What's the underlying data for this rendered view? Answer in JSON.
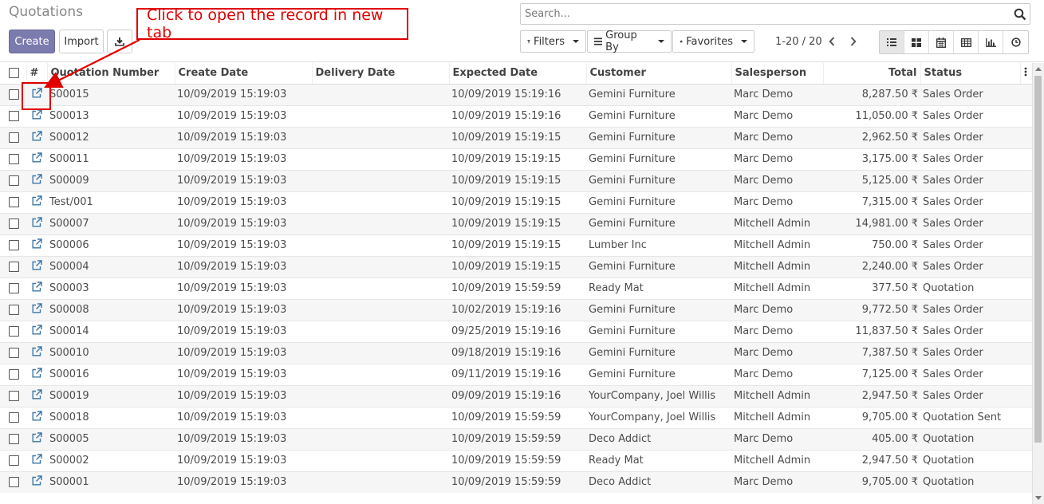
{
  "header": {
    "title": "Quotations",
    "create_label": "Create",
    "import_label": "Import",
    "search_placeholder": "Search...",
    "filters_label": "Filters",
    "groupby_label": "Group By",
    "favorites_label": "Favorites",
    "pager": "1-20 / 20"
  },
  "annotation": {
    "text": "Click to open the record in new tab",
    "color": "#e00000"
  },
  "colors": {
    "primary": "#7c7bad",
    "annotation": "#e00000"
  },
  "table": {
    "columns": [
      "#",
      "Quotation Number",
      "Create Date",
      "Delivery Date",
      "Expected Date",
      "Customer",
      "Salesperson",
      "Total",
      "Status"
    ],
    "rows": [
      {
        "number": "S00015",
        "create": "10/09/2019 15:19:03",
        "delivery": "",
        "expected": "10/09/2019 15:19:16",
        "customer": "Gemini Furniture",
        "salesperson": "Marc Demo",
        "total": "8,287.50 ₹",
        "status": "Sales Order"
      },
      {
        "number": "S00013",
        "create": "10/09/2019 15:19:03",
        "delivery": "",
        "expected": "10/09/2019 15:19:16",
        "customer": "Gemini Furniture",
        "salesperson": "Marc Demo",
        "total": "11,050.00 ₹",
        "status": "Sales Order"
      },
      {
        "number": "S00012",
        "create": "10/09/2019 15:19:03",
        "delivery": "",
        "expected": "10/09/2019 15:19:15",
        "customer": "Gemini Furniture",
        "salesperson": "Marc Demo",
        "total": "2,962.50 ₹",
        "status": "Sales Order"
      },
      {
        "number": "S00011",
        "create": "10/09/2019 15:19:03",
        "delivery": "",
        "expected": "10/09/2019 15:19:15",
        "customer": "Gemini Furniture",
        "salesperson": "Marc Demo",
        "total": "3,175.00 ₹",
        "status": "Sales Order"
      },
      {
        "number": "S00009",
        "create": "10/09/2019 15:19:03",
        "delivery": "",
        "expected": "10/09/2019 15:19:15",
        "customer": "Gemini Furniture",
        "salesperson": "Marc Demo",
        "total": "5,125.00 ₹",
        "status": "Sales Order"
      },
      {
        "number": "Test/001",
        "create": "10/09/2019 15:19:03",
        "delivery": "",
        "expected": "10/09/2019 15:19:15",
        "customer": "Gemini Furniture",
        "salesperson": "Marc Demo",
        "total": "7,315.00 ₹",
        "status": "Sales Order"
      },
      {
        "number": "S00007",
        "create": "10/09/2019 15:19:03",
        "delivery": "",
        "expected": "10/09/2019 15:19:15",
        "customer": "Gemini Furniture",
        "salesperson": "Mitchell Admin",
        "total": "14,981.00 ₹",
        "status": "Sales Order"
      },
      {
        "number": "S00006",
        "create": "10/09/2019 15:19:03",
        "delivery": "",
        "expected": "10/09/2019 15:19:15",
        "customer": "Lumber Inc",
        "salesperson": "Mitchell Admin",
        "total": "750.00 ₹",
        "status": "Sales Order"
      },
      {
        "number": "S00004",
        "create": "10/09/2019 15:19:03",
        "delivery": "",
        "expected": "10/09/2019 15:19:15",
        "customer": "Gemini Furniture",
        "salesperson": "Mitchell Admin",
        "total": "2,240.00 ₹",
        "status": "Sales Order"
      },
      {
        "number": "S00003",
        "create": "10/09/2019 15:19:03",
        "delivery": "",
        "expected": "10/09/2019 15:59:59",
        "customer": "Ready Mat",
        "salesperson": "Mitchell Admin",
        "total": "377.50 ₹",
        "status": "Quotation"
      },
      {
        "number": "S00008",
        "create": "10/09/2019 15:19:03",
        "delivery": "",
        "expected": "10/02/2019 15:19:16",
        "customer": "Gemini Furniture",
        "salesperson": "Marc Demo",
        "total": "9,772.50 ₹",
        "status": "Sales Order"
      },
      {
        "number": "S00014",
        "create": "10/09/2019 15:19:03",
        "delivery": "",
        "expected": "09/25/2019 15:19:16",
        "customer": "Gemini Furniture",
        "salesperson": "Marc Demo",
        "total": "11,837.50 ₹",
        "status": "Sales Order"
      },
      {
        "number": "S00010",
        "create": "10/09/2019 15:19:03",
        "delivery": "",
        "expected": "09/18/2019 15:19:16",
        "customer": "Gemini Furniture",
        "salesperson": "Marc Demo",
        "total": "7,387.50 ₹",
        "status": "Sales Order"
      },
      {
        "number": "S00016",
        "create": "10/09/2019 15:19:03",
        "delivery": "",
        "expected": "09/11/2019 15:19:16",
        "customer": "Gemini Furniture",
        "salesperson": "Marc Demo",
        "total": "7,125.00 ₹",
        "status": "Sales Order"
      },
      {
        "number": "S00019",
        "create": "10/09/2019 15:19:03",
        "delivery": "",
        "expected": "09/09/2019 15:19:16",
        "customer": "YourCompany, Joel Willis",
        "salesperson": "Mitchell Admin",
        "total": "2,947.50 ₹",
        "status": "Sales Order"
      },
      {
        "number": "S00018",
        "create": "10/09/2019 15:19:03",
        "delivery": "",
        "expected": "10/09/2019 15:59:59",
        "customer": "YourCompany, Joel Willis",
        "salesperson": "Mitchell Admin",
        "total": "9,705.00 ₹",
        "status": "Quotation Sent"
      },
      {
        "number": "S00005",
        "create": "10/09/2019 15:19:03",
        "delivery": "",
        "expected": "10/09/2019 15:59:59",
        "customer": "Deco Addict",
        "salesperson": "Marc Demo",
        "total": "405.00 ₹",
        "status": "Quotation"
      },
      {
        "number": "S00002",
        "create": "10/09/2019 15:19:03",
        "delivery": "",
        "expected": "10/09/2019 15:59:59",
        "customer": "Ready Mat",
        "salesperson": "Mitchell Admin",
        "total": "2,947.50 ₹",
        "status": "Quotation"
      },
      {
        "number": "S00001",
        "create": "10/09/2019 15:19:03",
        "delivery": "",
        "expected": "10/09/2019 15:59:59",
        "customer": "Deco Addict",
        "salesperson": "Marc Demo",
        "total": "9,705.00 ₹",
        "status": "Quotation"
      }
    ]
  }
}
